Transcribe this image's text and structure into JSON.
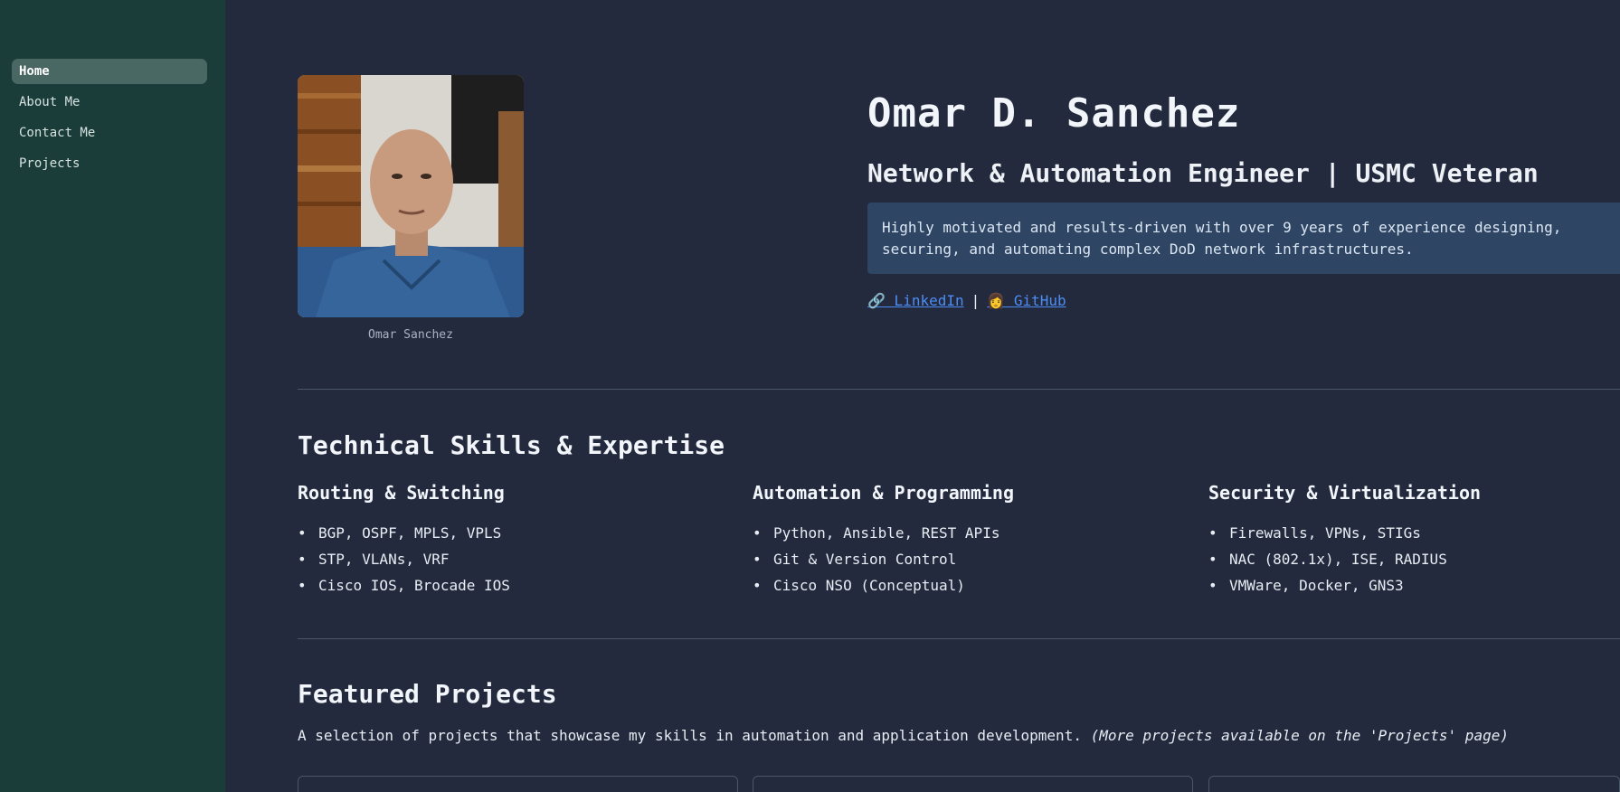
{
  "sidebar": {
    "items": [
      {
        "label": "Home",
        "active": true
      },
      {
        "label": "About Me",
        "active": false
      },
      {
        "label": "Contact Me",
        "active": false
      },
      {
        "label": "Projects",
        "active": false
      }
    ]
  },
  "profile": {
    "caption": "Omar Sanchez"
  },
  "hero": {
    "name": "Omar D. Sanchez",
    "title": "Network & Automation Engineer | USMC Veteran",
    "summary": "Highly motivated and results-driven with over 9 years of experience designing, securing, and automating complex DoD network infrastructures.",
    "linkedin_label": "🔗 LinkedIn",
    "separator": "|",
    "github_label": "👩 GitHub"
  },
  "skills": {
    "heading": "Technical Skills & Expertise",
    "columns": [
      {
        "title": "Routing & Switching",
        "items": [
          "BGP, OSPF, MPLS, VPLS",
          "STP, VLANs, VRF",
          "Cisco IOS, Brocade IOS"
        ]
      },
      {
        "title": "Automation & Programming",
        "items": [
          "Python, Ansible, REST APIs",
          "Git & Version Control",
          "Cisco NSO (Conceptual)"
        ]
      },
      {
        "title": "Security & Virtualization",
        "items": [
          "Firewalls, VPNs, STIGs",
          "NAC (802.1x), ISE, RADIUS",
          "VMWare, Docker, GNS3"
        ]
      }
    ]
  },
  "projects": {
    "heading": "Featured Projects",
    "intro": "A selection of projects that showcase my skills in automation and application development.",
    "intro_note": "(More projects available on the 'Projects' page)"
  },
  "colors": {
    "sidebar_bg": "#1a3d39",
    "page_bg": "#232a3d",
    "active_nav": "#4a6863",
    "summary_bg": "#2e4563",
    "link": "#4c8df5"
  }
}
